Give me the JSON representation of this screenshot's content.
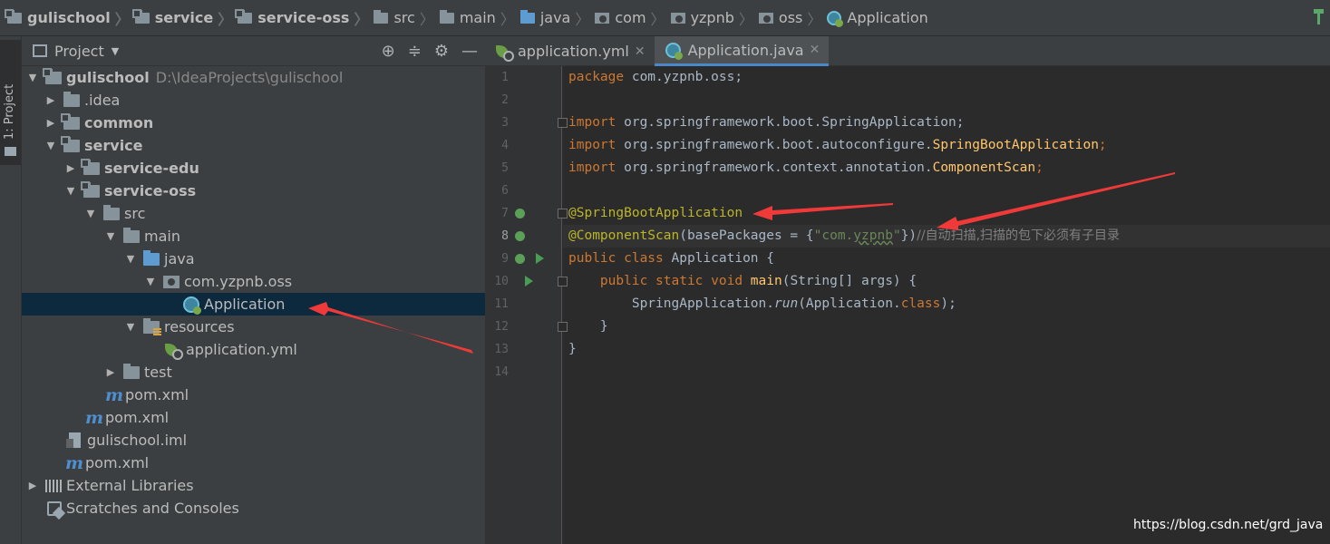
{
  "breadcrumb": [
    {
      "label": "gulischool",
      "icon": "module-folder-icon"
    },
    {
      "label": "service",
      "icon": "module-folder-icon"
    },
    {
      "label": "service-oss",
      "icon": "module-folder-icon"
    },
    {
      "label": "src",
      "icon": "folder-icon"
    },
    {
      "label": "main",
      "icon": "folder-icon"
    },
    {
      "label": "java",
      "icon": "source-folder-icon"
    },
    {
      "label": "com",
      "icon": "package-icon"
    },
    {
      "label": "yzpnb",
      "icon": "package-icon"
    },
    {
      "label": "oss",
      "icon": "package-icon"
    },
    {
      "label": "Application",
      "icon": "spring-boot-class-icon"
    }
  ],
  "tool_stripe": {
    "project_tab": "1: Project"
  },
  "project_panel": {
    "title": "Project",
    "tree": [
      {
        "label": "gulischool",
        "path": "D:\\IdeaProjects\\gulischool"
      },
      {
        "label": ".idea"
      },
      {
        "label": "common"
      },
      {
        "label": "service"
      },
      {
        "label": "service-edu"
      },
      {
        "label": "service-oss"
      },
      {
        "label": "src"
      },
      {
        "label": "main"
      },
      {
        "label": "java"
      },
      {
        "label": "com.yzpnb.oss"
      },
      {
        "label": "Application"
      },
      {
        "label": "resources"
      },
      {
        "label": "application.yml"
      },
      {
        "label": "test"
      },
      {
        "label": "pom.xml"
      },
      {
        "label": "pom.xml"
      },
      {
        "label": "gulischool.iml"
      },
      {
        "label": "pom.xml"
      },
      {
        "label": "External Libraries"
      },
      {
        "label": "Scratches and Consoles"
      }
    ]
  },
  "editor": {
    "tabs": [
      {
        "label": "application.yml",
        "active": false
      },
      {
        "label": "Application.java",
        "active": true
      }
    ],
    "line_numbers": [
      "1",
      "2",
      "3",
      "4",
      "5",
      "6",
      "7",
      "8",
      "9",
      "10",
      "11",
      "12",
      "13",
      "14"
    ],
    "current_line": 8,
    "code": {
      "l1_kw": "package",
      "l1_rest": " com.yzpnb.oss;",
      "l3_kw": "import",
      "l3_rest": " org.springframework.boot.SpringApplication;",
      "l4_kw": "import",
      "l4_rest": " org.springframework.boot.autoconfigure.",
      "l4_cls": "SpringBootApplication",
      "l4_end": ";",
      "l5_kw": "import",
      "l5_rest": " org.springframework.context.annotation.",
      "l5_cls": "ComponentScan",
      "l5_end": ";",
      "l7_ann": "@SpringBootApplication",
      "l8_ann": "@ComponentScan",
      "l8_a": "(basePackages = {",
      "l8_str1": "\"com.",
      "l8_str2": "yzpnb",
      "l8_str3": "\"",
      "l8_b": "})",
      "l8_cm": "//自动扫描,扫描的包下必须有子目录",
      "l9_kw": "public class",
      "l9_rest": " Application {",
      "l10_kw": "public static void",
      "l10_fn": " main",
      "l10_rest": "(String[] args) {",
      "l11_a": "SpringApplication.",
      "l11_fn": "run",
      "l11_b": "(Application.",
      "l11_kw": "class",
      "l11_c": ");",
      "l12": "}",
      "l13": "}"
    }
  },
  "watermark": "https://blog.csdn.net/grd_java",
  "colors": {
    "annotation_arrow": "#f03a3a",
    "keyword": "#cc7832",
    "annotation": "#bbb529",
    "string": "#6a8759"
  }
}
